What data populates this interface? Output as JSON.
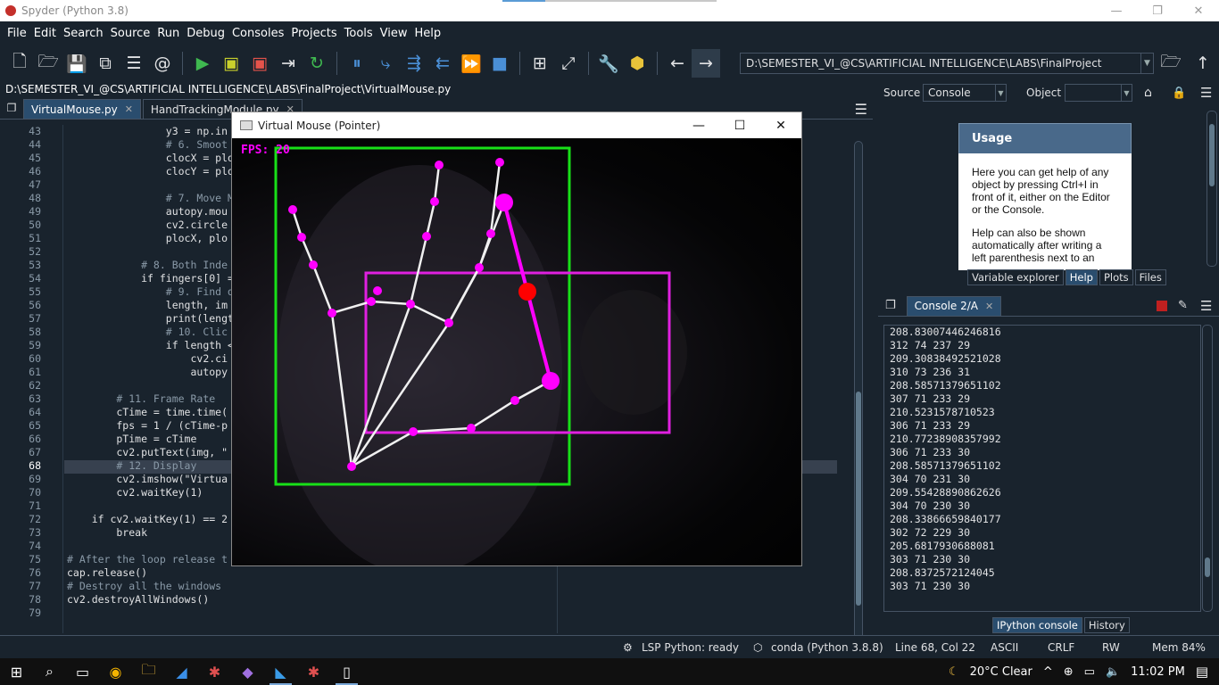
{
  "window": {
    "title": "Spyder (Python 3.8)",
    "minimize": "—",
    "restore": "❐",
    "close": "✕"
  },
  "menu": [
    "File",
    "Edit",
    "Search",
    "Source",
    "Run",
    "Debug",
    "Consoles",
    "Projects",
    "Tools",
    "View",
    "Help"
  ],
  "toolbar": {
    "path": "D:\\SEMESTER_VI_@CS\\ARTIFICIAL INTELLIGENCE\\LABS\\FinalProject"
  },
  "editor": {
    "file_path": "D:\\SEMESTER_VI_@CS\\ARTIFICIAL INTELLIGENCE\\LABS\\FinalProject\\VirtualMouse.py",
    "tabs": [
      {
        "label": "VirtualMouse.py",
        "close": "✕"
      },
      {
        "label": "HandTrackingModule.py",
        "close": "✕"
      }
    ],
    "lines": [
      {
        "n": "43",
        "t": "                y3 = np.in"
      },
      {
        "n": "44",
        "t": "                # 6. Smoot"
      },
      {
        "n": "45",
        "t": "                clocX = plo"
      },
      {
        "n": "46",
        "t": "                clocY = plo"
      },
      {
        "n": "47",
        "t": ""
      },
      {
        "n": "48",
        "t": "                # 7. Move M"
      },
      {
        "n": "49",
        "t": "                autopy.mou"
      },
      {
        "n": "50",
        "t": "                cv2.circle"
      },
      {
        "n": "51",
        "t": "                plocX, plo"
      },
      {
        "n": "52",
        "t": ""
      },
      {
        "n": "53",
        "t": "            # 8. Both Inde"
      },
      {
        "n": "54",
        "t": "            if fingers[0] ="
      },
      {
        "n": "55",
        "t": "                # 9. Find d"
      },
      {
        "n": "56",
        "t": "                length, im"
      },
      {
        "n": "57",
        "t": "                print(lengt"
      },
      {
        "n": "58",
        "t": "                # 10. Clic"
      },
      {
        "n": "59",
        "t": "                if length <"
      },
      {
        "n": "60",
        "t": "                    cv2.ci"
      },
      {
        "n": "61",
        "t": "                    autopy"
      },
      {
        "n": "62",
        "t": ""
      },
      {
        "n": "63",
        "t": "        # 11. Frame Rate"
      },
      {
        "n": "64",
        "t": "        cTime = time.time("
      },
      {
        "n": "65",
        "t": "        fps = 1 / (cTime-p"
      },
      {
        "n": "66",
        "t": "        pTime = cTime"
      },
      {
        "n": "67",
        "t": "        cv2.putText(img, \""
      },
      {
        "n": "68",
        "t": "        # 12. Display"
      },
      {
        "n": "69",
        "t": "        cv2.imshow(\"Virtua"
      },
      {
        "n": "70",
        "t": "        cv2.waitKey(1)"
      },
      {
        "n": "71",
        "t": ""
      },
      {
        "n": "72",
        "t": "    if cv2.waitKey(1) == 2"
      },
      {
        "n": "73",
        "t": "        break"
      },
      {
        "n": "74",
        "t": ""
      },
      {
        "n": "75",
        "t": "# After the loop release t"
      },
      {
        "n": "76",
        "t": "cap.release()"
      },
      {
        "n": "77",
        "t": "# Destroy all the windows"
      },
      {
        "n": "78",
        "t": "cv2.destroyAllWindows()"
      },
      {
        "n": "79",
        "t": ""
      }
    ]
  },
  "virtual_mouse": {
    "title": "Virtual Mouse (Pointer)",
    "fps_text": "FPS: 20",
    "minimize": "—",
    "maximize": "☐",
    "close": "✕"
  },
  "help": {
    "source_label": "Source",
    "source_value": "Console",
    "object_label": "Object",
    "object_value": "",
    "usage_title": "Usage",
    "usage_p1": "Here you can get help of any object by pressing Ctrl+I in front of it, either on the Editor or the Console.",
    "usage_p2": "Help can also be shown automatically after writing a left parenthesis next to an",
    "tabs": [
      "Variable explorer",
      "Help",
      "Plots",
      "Files"
    ]
  },
  "console": {
    "tab": "Console 2/A",
    "lines": [
      "208.83007446246816",
      "312 74 237 29",
      "209.30838492521028",
      "310 73 236 31",
      "208.58571379651102",
      "307 71 233 29",
      "210.5231578710523",
      "306 71 233 29",
      "210.77238908357992",
      "306 71 233 30",
      "208.58571379651102",
      "304 70 231 30",
      "209.55428890862626",
      "304 70 230 30",
      "208.33866659840177",
      "302 72 229 30",
      "205.6817930688081",
      "303 71 230 30",
      "208.8372572124045",
      "303 71 230 30"
    ],
    "bottom_tabs": [
      "IPython console",
      "History"
    ]
  },
  "status": {
    "lsp": "LSP Python: ready",
    "conda": "conda (Python 3.8.8)",
    "position": "Line 68, Col 22",
    "encoding": "ASCII",
    "eol": "CRLF",
    "mode": "RW",
    "mem": "Mem 84%"
  },
  "taskbar": {
    "weather": "20°C  Clear",
    "time": "11:02 PM"
  }
}
